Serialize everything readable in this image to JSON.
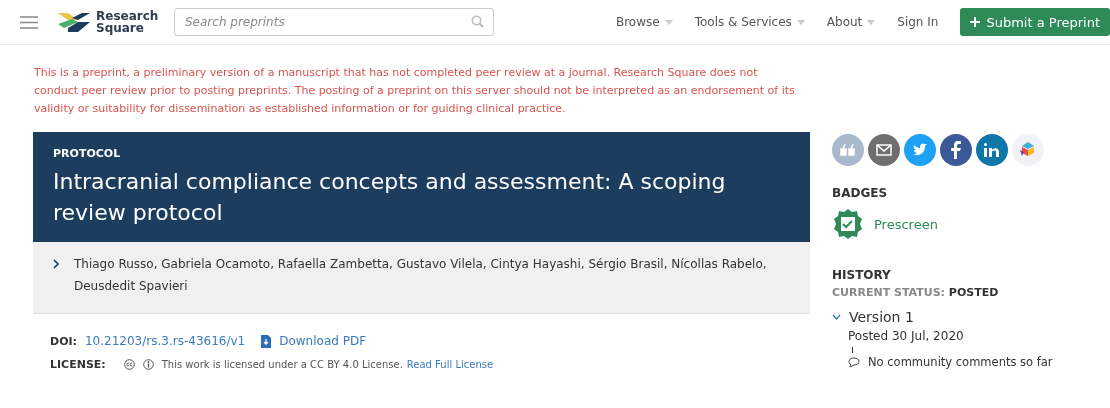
{
  "header": {
    "logo": [
      "Research",
      "Square"
    ],
    "search": {
      "placeholder": "Search preprints"
    },
    "nav": [
      {
        "label": "Browse",
        "dropdown": true
      },
      {
        "label": "Tools & Services",
        "dropdown": true
      },
      {
        "label": "About",
        "dropdown": true
      },
      {
        "label": "Sign In",
        "dropdown": false
      }
    ],
    "submit_button": "Submit a Preprint"
  },
  "disclaimer": "This is a preprint, a preliminary version of a manuscript that has not completed peer review at a journal. Research Square does not conduct peer review prior to posting preprints. The posting of a preprint on this server should not be interpreted as an endorsement of its validity or suitability for dissemination as established information or for guiding clinical practice.",
  "article": {
    "type": "PROTOCOL",
    "title": "Intracranial compliance concepts and assessment: A scoping review protocol",
    "authors": {
      "expanded": false,
      "text": "Thiago Russo, Gabriela Ocamoto, Rafaella Zambetta, Gustavo Vilela, Cintya Hayashi, Sérgio Brasil, Nícollas Rabelo, Deusdedit Spavieri"
    },
    "doi_label": "DOI:",
    "doi": "10.21203/rs.3.rs-43616/v1",
    "download": "Download PDF",
    "license_label": "LICENSE:",
    "license_text": "This work is licensed under a CC BY 4.0 License.",
    "license_link": "Read Full License"
  },
  "sidebar": {
    "share": [
      {
        "kind": "cite",
        "color": "#a9b8cc"
      },
      {
        "kind": "email",
        "color": "#6f6f6f"
      },
      {
        "kind": "twitter",
        "color": "#1da1f2"
      },
      {
        "kind": "facebook",
        "color": "#3b5998"
      },
      {
        "kind": "linkedin",
        "color": "#0e76a8"
      },
      {
        "kind": "mendeley",
        "color": "#f0f2f5"
      }
    ],
    "badges_title": "BADGES",
    "badge": "Prescreen",
    "history_title": "HISTORY",
    "status_label": "CURRENT STATUS:",
    "status_value": "POSTED",
    "versions": [
      {
        "label": "Version 1",
        "expanded": true,
        "posted": "Posted 30 Jul, 2020",
        "comments": "No community comments so far"
      }
    ]
  }
}
